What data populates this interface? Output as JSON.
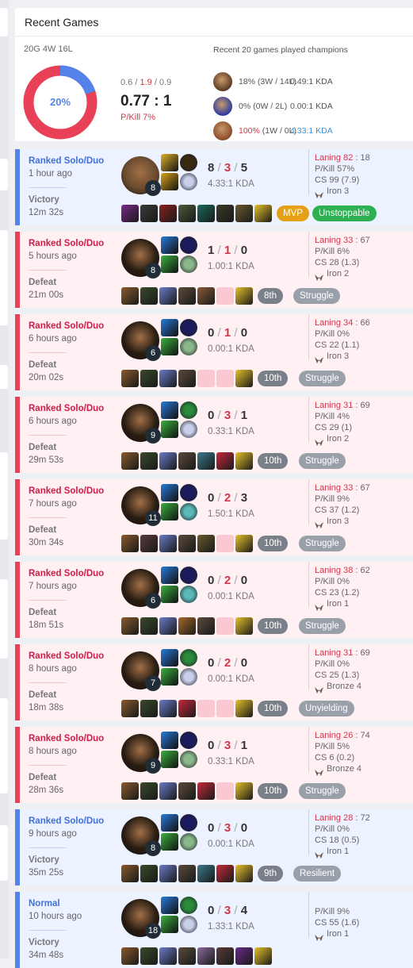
{
  "summary": {
    "title": "Recent Games",
    "record": "20G 4W 16L",
    "winrate_label": "20%",
    "winrate_fraction": 0.2,
    "avg_kills": "0.6",
    "avg_deaths": "1.9",
    "avg_assists": "0.9",
    "kda_ratio": "0.77 : 1",
    "pkill": "P/Kill 7%",
    "champions_title": "Recent 20 games played champions",
    "champions": [
      {
        "name": "champion-a",
        "winrate": "18%",
        "record": "(3W / 14L)",
        "kda": "0.49:1 KDA",
        "color": "#5a3a24",
        "pct_class": "",
        "kda_class": ""
      },
      {
        "name": "champion-b",
        "winrate": "0%",
        "record": "(0W / 2L)",
        "kda": "0.00:1 KDA",
        "color": "#2c3aa0",
        "pct_class": "",
        "kda_class": ""
      },
      {
        "name": "champion-c",
        "winrate": "100%",
        "record": "(1W / 0L)",
        "kda": "4.33:1 KDA",
        "color": "#8a4b2a",
        "pct_class": "lose-c",
        "kda_class": "win-c"
      }
    ],
    "colors": {
      "win": "#5383e8",
      "loss": "#e84057"
    }
  },
  "games": [
    {
      "queue": "Ranked Solo/Duo",
      "time": "1 hour ago",
      "result": "Victory",
      "duration": "12m 32s",
      "win": true,
      "level": "8",
      "k": "8",
      "d": "3",
      "a": "5",
      "ratio": "4.33:1 KDA",
      "laning": "Laning 82",
      "laning_opp": "18",
      "pkill": "P/Kill 57%",
      "cs": "CS 99 (7.9)",
      "tier": "Iron 3",
      "champ_color": "#6b4a2e",
      "spells": [
        "#e0b030",
        "#d9a21a"
      ],
      "runes": [
        "#3a2a10",
        "#c8d0ea"
      ],
      "items": [
        "#7a2a8a",
        "#3a3a3a",
        "#8a2020",
        "#4a5a3a",
        "#1a6a5a",
        "#3a3a2a",
        "#6a5a2a",
        "#e8c02a"
      ],
      "badges": [
        {
          "label": "MVP",
          "cls": "b-mvp"
        },
        {
          "label": "Unstoppable",
          "cls": "b-pos"
        }
      ]
    },
    {
      "queue": "Ranked Solo/Duo",
      "time": "5 hours ago",
      "result": "Defeat",
      "duration": "21m 00s",
      "win": false,
      "level": "8",
      "k": "1",
      "d": "1",
      "a": "0",
      "ratio": "1.00:1 KDA",
      "laning": "Laning 33",
      "laning_opp": "67",
      "pkill": "P/Kill 6%",
      "cs": "CS 28 (1.3)",
      "tier": "Iron 2",
      "champ_color": "#2a1d12",
      "spells": [
        "#2a7ad8",
        "#3ab040"
      ],
      "runes": [
        "#1a1a60",
        "#8ab88a"
      ],
      "items": [
        "#8a5a2a",
        "#3a4a2a",
        "#6a7ac8",
        "#5a4a3a",
        "#8a5a3a",
        "empty",
        "#e8c02a"
      ],
      "badges": [
        {
          "label": "8th",
          "cls": "b-place"
        },
        {
          "label": "Struggle",
          "cls": "b-grey"
        }
      ]
    },
    {
      "queue": "Ranked Solo/Duo",
      "time": "6 hours ago",
      "result": "Defeat",
      "duration": "20m 02s",
      "win": false,
      "level": "6",
      "k": "0",
      "d": "1",
      "a": "0",
      "ratio": "0.00:1 KDA",
      "laning": "Laning 34",
      "laning_opp": "66",
      "pkill": "P/Kill 0%",
      "cs": "CS 22 (1.1)",
      "tier": "Iron 3",
      "champ_color": "#2a1d12",
      "spells": [
        "#2a7ad8",
        "#3ab040"
      ],
      "runes": [
        "#1a1a60",
        "#8ab88a"
      ],
      "items": [
        "#8a5a2a",
        "#3a4a2a",
        "#6a7ac8",
        "#5a4a3a",
        "empty",
        "empty",
        "#e8c02a"
      ],
      "badges": [
        {
          "label": "10th",
          "cls": "b-place"
        },
        {
          "label": "Struggle",
          "cls": "b-grey"
        }
      ]
    },
    {
      "queue": "Ranked Solo/Duo",
      "time": "6 hours ago",
      "result": "Defeat",
      "duration": "29m 53s",
      "win": false,
      "level": "9",
      "k": "0",
      "d": "3",
      "a": "1",
      "ratio": "0.33:1 KDA",
      "laning": "Laning 31",
      "laning_opp": "69",
      "pkill": "P/Kill 4%",
      "cs": "CS 29 (1)",
      "tier": "Iron 2",
      "champ_color": "#2a1d12",
      "spells": [
        "#2a7ad8",
        "#3ab040"
      ],
      "runes": [
        "#2a8a3a",
        "#c8d0ea"
      ],
      "items": [
        "#8a5a2a",
        "#3a4a2a",
        "#6a7ac8",
        "#5a4a3a",
        "#3a7a8a",
        "#c82a3a",
        "#e8c02a"
      ],
      "badges": [
        {
          "label": "10th",
          "cls": "b-place"
        },
        {
          "label": "Struggle",
          "cls": "b-grey"
        }
      ]
    },
    {
      "queue": "Ranked Solo/Duo",
      "time": "7 hours ago",
      "result": "Defeat",
      "duration": "30m 34s",
      "win": false,
      "level": "11",
      "k": "0",
      "d": "2",
      "a": "3",
      "ratio": "1.50:1 KDA",
      "laning": "Laning 33",
      "laning_opp": "67",
      "pkill": "P/Kill 9%",
      "cs": "CS 37 (1.2)",
      "tier": "Iron 3",
      "champ_color": "#2a1d12",
      "spells": [
        "#2a7ad8",
        "#3ab040"
      ],
      "runes": [
        "#1a1a60",
        "#5ab8b8"
      ],
      "items": [
        "#8a5a2a",
        "#5a3a3a",
        "#6a7ac8",
        "#5a4a3a",
        "#6a5a2a",
        "empty",
        "#e8c02a"
      ],
      "badges": [
        {
          "label": "10th",
          "cls": "b-place"
        },
        {
          "label": "Struggle",
          "cls": "b-grey"
        }
      ]
    },
    {
      "queue": "Ranked Solo/Duo",
      "time": "7 hours ago",
      "result": "Defeat",
      "duration": "18m 51s",
      "win": false,
      "level": "6",
      "k": "0",
      "d": "2",
      "a": "0",
      "ratio": "0.00:1 KDA",
      "laning": "Laning 38",
      "laning_opp": "62",
      "pkill": "P/Kill 0%",
      "cs": "CS 23 (1.2)",
      "tier": "Iron 1",
      "champ_color": "#2a1d12",
      "spells": [
        "#2a7ad8",
        "#3ab040"
      ],
      "runes": [
        "#1a1a60",
        "#5ab8b8"
      ],
      "items": [
        "#8a5a2a",
        "#3a4a2a",
        "#6a7ac8",
        "#a8682a",
        "#5a4a3a",
        "empty",
        "#e8c02a"
      ],
      "badges": [
        {
          "label": "10th",
          "cls": "b-place"
        },
        {
          "label": "Struggle",
          "cls": "b-grey"
        }
      ]
    },
    {
      "queue": "Ranked Solo/Duo",
      "time": "8 hours ago",
      "result": "Defeat",
      "duration": "18m 38s",
      "win": false,
      "level": "7",
      "k": "0",
      "d": "2",
      "a": "0",
      "ratio": "0.00:1 KDA",
      "laning": "Laning 31",
      "laning_opp": "69",
      "pkill": "P/Kill 0%",
      "cs": "CS 25 (1.3)",
      "tier": "Bronze 4",
      "champ_color": "#2a1d12",
      "spells": [
        "#2a7ad8",
        "#3ab040"
      ],
      "runes": [
        "#2a8a3a",
        "#c8d0ea"
      ],
      "items": [
        "#8a5a2a",
        "#3a4a2a",
        "#6a7ac8",
        "#c82a3a",
        "empty",
        "empty",
        "#e8c02a"
      ],
      "badges": [
        {
          "label": "10th",
          "cls": "b-place"
        },
        {
          "label": "Unyielding",
          "cls": "b-grey"
        }
      ]
    },
    {
      "queue": "Ranked Solo/Duo",
      "time": "8 hours ago",
      "result": "Defeat",
      "duration": "28m 36s",
      "win": false,
      "level": "9",
      "k": "0",
      "d": "3",
      "a": "1",
      "ratio": "0.33:1 KDA",
      "laning": "Laning 26",
      "laning_opp": "74",
      "pkill": "P/Kill 5%",
      "cs": "CS 6 (0.2)",
      "tier": "Bronze 4",
      "champ_color": "#2a1d12",
      "spells": [
        "#2a7ad8",
        "#3ab040"
      ],
      "runes": [
        "#1a1a60",
        "#8ab88a"
      ],
      "items": [
        "#8a5a2a",
        "#3a4a2a",
        "#6a7ac8",
        "#5a4a3a",
        "#c82a3a",
        "empty",
        "#e8c02a"
      ],
      "badges": [
        {
          "label": "10th",
          "cls": "b-place"
        },
        {
          "label": "Struggle",
          "cls": "b-grey"
        }
      ]
    },
    {
      "queue": "Ranked Solo/Duo",
      "time": "9 hours ago",
      "result": "Victory",
      "duration": "35m 25s",
      "win": true,
      "level": "8",
      "k": "0",
      "d": "3",
      "a": "0",
      "ratio": "0.00:1 KDA",
      "laning": "Laning 28",
      "laning_opp": "72",
      "pkill": "P/Kill 0%",
      "cs": "CS 18 (0.5)",
      "tier": "Iron 1",
      "champ_color": "#2a1d12",
      "spells": [
        "#2a7ad8",
        "#3ab040"
      ],
      "runes": [
        "#1a1a60",
        "#8ab88a"
      ],
      "items": [
        "#8a5a2a",
        "#3a4a2a",
        "#6a7ac8",
        "#5a4a3a",
        "#3a7a8a",
        "#c82a3a",
        "#e8c02a"
      ],
      "badges": [
        {
          "label": "9th",
          "cls": "b-win"
        },
        {
          "label": "Resilient",
          "cls": "b-grey"
        }
      ]
    },
    {
      "queue": "Normal",
      "time": "10 hours ago",
      "result": "Victory",
      "duration": "34m 48s",
      "win": true,
      "level": "18",
      "k": "0",
      "d": "3",
      "a": "4",
      "ratio": "1.33:1 KDA",
      "laning": "",
      "laning_opp": "",
      "pkill": "P/Kill 9%",
      "cs": "CS 55 (1.6)",
      "tier": "Iron 1",
      "champ_color": "#2a1d12",
      "spells": [
        "#2a7ad8",
        "#3ab040"
      ],
      "runes": [
        "#2a8a3a",
        "#c8d0ea"
      ],
      "items": [
        "#8a5a2a",
        "#3a4a2a",
        "#6a7ac8",
        "#5a4a3a",
        "#8a6a9a",
        "#5a3a3a",
        "#6a2a8a",
        "#e8c02a"
      ],
      "badges": []
    }
  ]
}
